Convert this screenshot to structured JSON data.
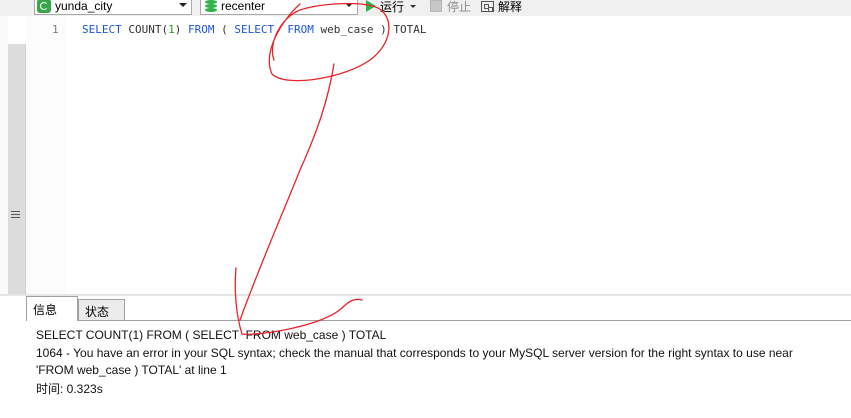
{
  "toolbar": {
    "connection": "yunda_city",
    "database": "recenter",
    "run_label": "运行",
    "stop_label": "停止",
    "explain_label": "解释"
  },
  "editor": {
    "line_number": "1",
    "code_tokens": [
      {
        "t": "SELECT",
        "c": "kw"
      },
      {
        "t": " COUNT(",
        "c": ""
      },
      {
        "t": "1",
        "c": "num"
      },
      {
        "t": ") ",
        "c": ""
      },
      {
        "t": "FROM",
        "c": "kw"
      },
      {
        "t": " ( ",
        "c": ""
      },
      {
        "t": "SELECT",
        "c": "kw"
      },
      {
        "t": "  ",
        "c": ""
      },
      {
        "t": "FROM",
        "c": "kw"
      },
      {
        "t": " web_case ) TOTAL",
        "c": ""
      }
    ]
  },
  "tabs": [
    {
      "label": "信息",
      "active": true
    },
    {
      "label": "状态",
      "active": false
    }
  ],
  "output": {
    "query": "SELECT COUNT(1) FROM ( SELECT  FROM web_case ) TOTAL",
    "error_line1": "1064 - You have an error in your SQL syntax; check the manual that corresponds to your MySQL server version for the right syntax to use near",
    "error_line2": "'FROM web_case ) TOTAL' at line 1",
    "time": "时间: 0.323s"
  },
  "colors": {
    "keyword": "#1b55d6",
    "number": "#2a9b2a",
    "annotation": "#e8242b",
    "run_icon": "#2bb24c"
  }
}
